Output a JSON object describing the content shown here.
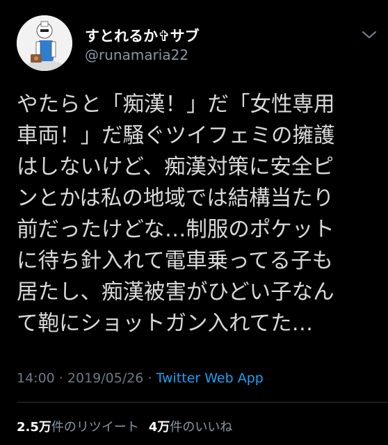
{
  "user": {
    "display_name": "すとれるか✞サブ",
    "handle": "@runamaria22"
  },
  "tweet": {
    "lines": [
      "やたらと「痴漢！」だ「女性専用",
      "車両！」だ騒ぐツイフェミの擁護",
      "はしないけど、痴漢対策に安全ピ",
      "ンとかは私の地域では結構当たり",
      "前だったけどな…制服のポケット",
      "に待ち針入れて電車乗ってる子も",
      "居たし、痴漢被害がひどい子なん",
      "て鞄にショットガン入れてた…"
    ]
  },
  "meta": {
    "time": "14:00",
    "separator": " · ",
    "date": "2019/05/26",
    "source": "Twitter Web App"
  },
  "stats": {
    "retweets_count": "2.5万",
    "retweets_label": "件のリツイート",
    "likes_count": "4万",
    "likes_label": "件のいいね"
  },
  "colors": {
    "background": "#000000",
    "text": "#d9d9d9",
    "secondary": "#8b98a5",
    "link": "#1da1f2"
  },
  "icons": {
    "caret": "chevron-down-icon"
  }
}
